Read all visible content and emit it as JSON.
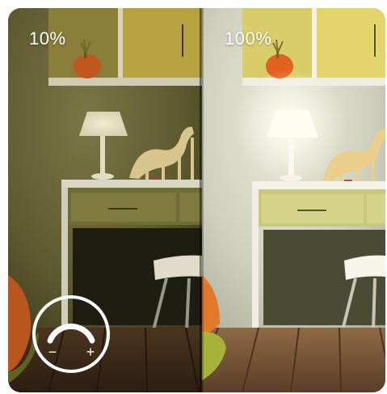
{
  "comparison": {
    "left_label": "10%",
    "right_label": "100%"
  },
  "dimmer_icon": {
    "icon": "brightness-dial-icon",
    "minus_symbol": "−",
    "plus_symbol": "+"
  },
  "colors": {
    "dim_wall": "#6f6a3c",
    "bright_wall": "#dcdcc6",
    "cabinet_yellow": "#d8c958",
    "floor_wood": "#5a3e28"
  }
}
